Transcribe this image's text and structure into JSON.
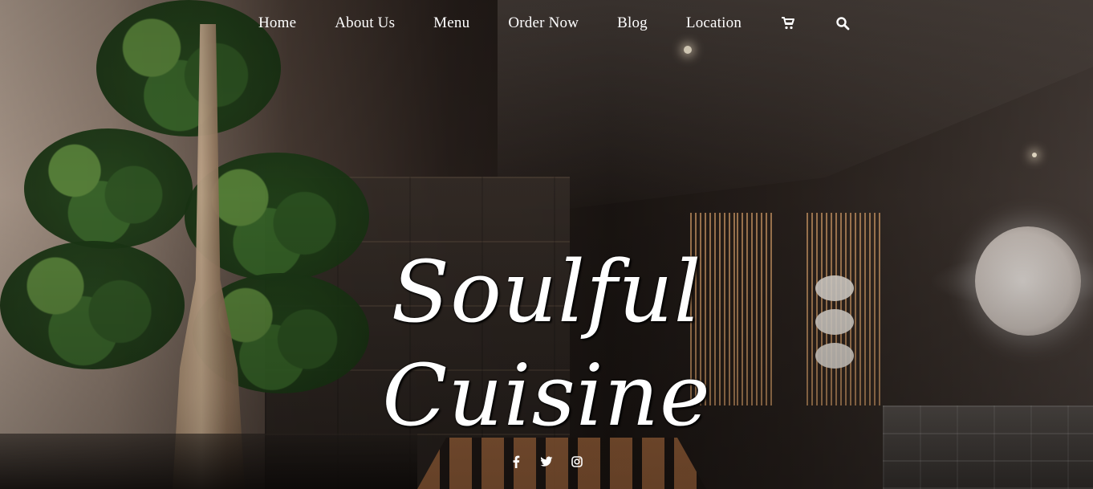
{
  "nav": {
    "items": [
      {
        "label": "Home"
      },
      {
        "label": "About Us"
      },
      {
        "label": "Menu"
      },
      {
        "label": "Order Now"
      },
      {
        "label": "Blog"
      },
      {
        "label": "Location"
      }
    ],
    "icons": [
      "cart-icon",
      "search-icon"
    ]
  },
  "hero": {
    "title_line1": "Soulful",
    "title_line2": "Cuisine",
    "background_image": "restaurant-interior-photo"
  },
  "social": {
    "icons": [
      "facebook-icon",
      "twitter-icon",
      "instagram-icon"
    ]
  },
  "colors": {
    "text": "#ffffff"
  }
}
